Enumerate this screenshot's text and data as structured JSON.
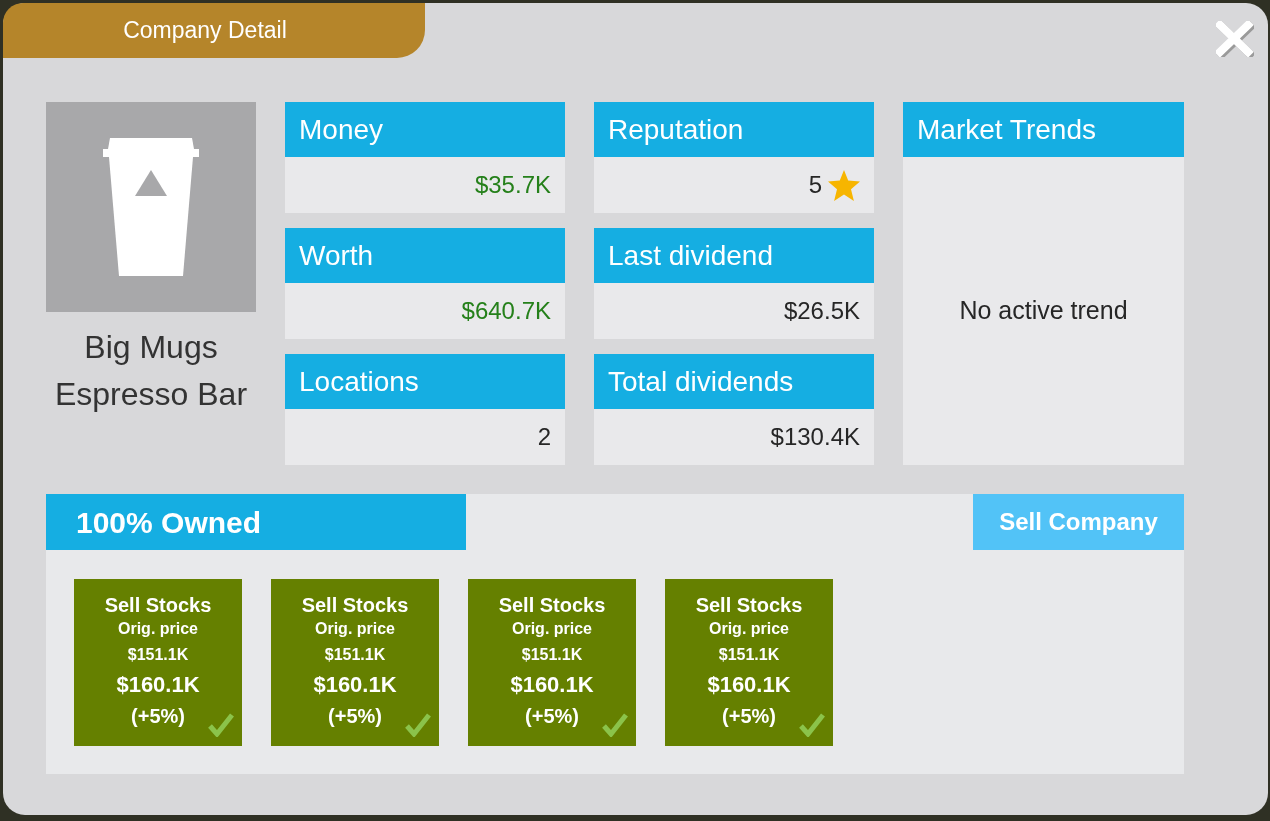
{
  "dialog": {
    "title": "Company Detail"
  },
  "company": {
    "name": "Big Mugs Espresso Bar"
  },
  "stats": [
    {
      "label": "Money",
      "value": "$35.7K",
      "kind": "gain"
    },
    {
      "label": "Reputation",
      "value": "5",
      "kind": "rating"
    },
    {
      "label": "Worth",
      "value": "$640.7K",
      "kind": "gain"
    },
    {
      "label": "Last dividend",
      "value": "$26.5K",
      "kind": "plain"
    },
    {
      "label": "Locations",
      "value": "2",
      "kind": "plain"
    },
    {
      "label": "Total dividends",
      "value": "$130.4K",
      "kind": "plain"
    }
  ],
  "market_trends": {
    "title": "Market Trends",
    "message": "No active trend"
  },
  "ownership": {
    "title": "100% Owned",
    "sell_button": "Sell Company",
    "stocks": [
      {
        "title": "Sell Stocks",
        "orig_label": "Orig. price",
        "orig_price": "$151.1K",
        "price": "$160.1K",
        "change": "(+5%)",
        "checked": true
      },
      {
        "title": "Sell Stocks",
        "orig_label": "Orig. price",
        "orig_price": "$151.1K",
        "price": "$160.1K",
        "change": "(+5%)",
        "checked": true
      },
      {
        "title": "Sell Stocks",
        "orig_label": "Orig. price",
        "orig_price": "$151.1K",
        "price": "$160.1K",
        "change": "(+5%)",
        "checked": true
      },
      {
        "title": "Sell Stocks",
        "orig_label": "Orig. price",
        "orig_price": "$151.1K",
        "price": "$160.1K",
        "change": "(+5%)",
        "checked": true
      }
    ]
  }
}
